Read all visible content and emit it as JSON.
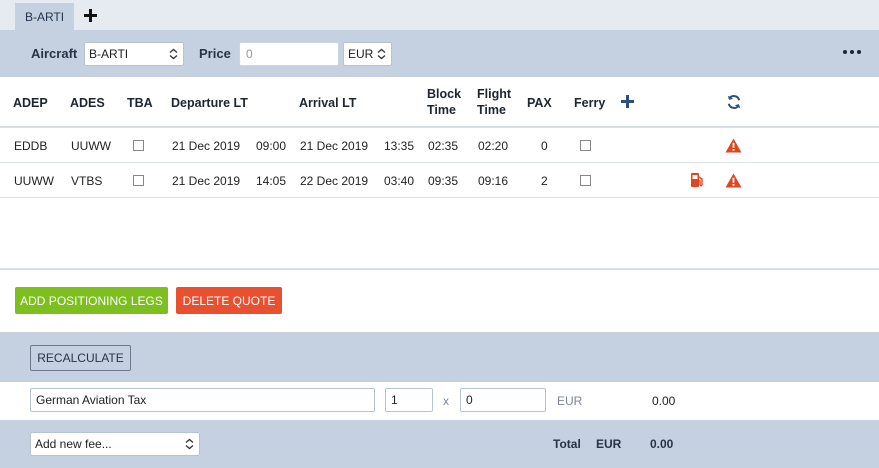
{
  "tabs": [
    {
      "label": "B-ARTI"
    }
  ],
  "toolbar": {
    "aircraft_label": "Aircraft",
    "aircraft_value": "B-ARTI",
    "price_label": "Price",
    "price_placeholder": "0",
    "currency_value": "EUR"
  },
  "columns": {
    "adep": "ADEP",
    "ades": "ADES",
    "tba": "TBA",
    "departure": "Departure LT",
    "arrival": "Arrival LT",
    "block_line1": "Block",
    "block_line2": "Time",
    "flight_line1": "Flight",
    "flight_line2": "Time",
    "pax": "PAX",
    "ferry": "Ferry"
  },
  "legs": [
    {
      "adep": "EDDB",
      "ades": "UUWW",
      "dep_date": "21 Dec 2019",
      "dep_time": "09:00",
      "arr_date": "21 Dec 2019",
      "arr_time": "13:35",
      "block": "02:35",
      "flight": "02:20",
      "pax": "0",
      "fuel_icon": false,
      "warning_icon": true
    },
    {
      "adep": "UUWW",
      "ades": "VTBS",
      "dep_date": "21 Dec 2019",
      "dep_time": "14:05",
      "arr_date": "22 Dec 2019",
      "arr_time": "03:40",
      "block": "09:35",
      "flight": "09:16",
      "pax": "2",
      "fuel_icon": true,
      "warning_icon": true
    }
  ],
  "actions": {
    "add_positioning": "ADD POSITIONING LEGS",
    "delete_quote": "DELETE QUOTE",
    "recalculate": "RECALCULATE"
  },
  "fees": [
    {
      "name": "German Aviation Tax",
      "quantity": "1",
      "multiplier_sign": "x",
      "price": "0",
      "currency": "EUR",
      "total": "0.00"
    }
  ],
  "footer": {
    "add_fee_placeholder": "Add new fee...",
    "total_label": "Total",
    "total_currency": "EUR",
    "total_value": "0.00"
  },
  "colors": {
    "band": "#c5d1e1",
    "green_button": "#7cbf1e",
    "red_button": "#e85030",
    "warning": "#e0461f",
    "accent": "#2b4f7e"
  },
  "icons": [
    "plus-icon",
    "more-icon",
    "refresh-icon",
    "warning-icon",
    "fuel-icon",
    "select-arrows-icon"
  ]
}
